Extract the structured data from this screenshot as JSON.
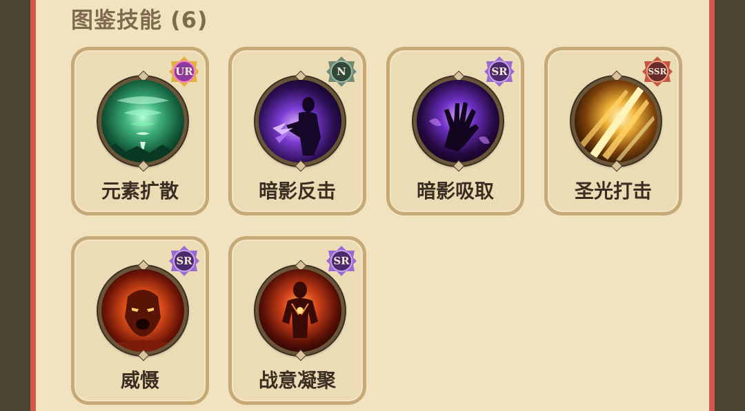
{
  "section": {
    "title": "图鉴技能 (6)"
  },
  "skills": [
    {
      "name": "元素扩散",
      "rarity": "UR",
      "icon": "green-tornado-icon",
      "theme": "green",
      "badge_color": "#8c3a9a"
    },
    {
      "name": "暗影反击",
      "rarity": "N",
      "icon": "shadow-figure-icon",
      "theme": "purple",
      "badge_color": "#2f4a3a"
    },
    {
      "name": "暗影吸取",
      "rarity": "SR",
      "icon": "shadow-hand-icon",
      "theme": "purple",
      "badge_color": "#4b2a6a"
    },
    {
      "name": "圣光打击",
      "rarity": "SSR",
      "icon": "holy-light-strike-icon",
      "theme": "gold",
      "badge_color": "#6a2a2a"
    },
    {
      "name": "威慑",
      "rarity": "SR",
      "icon": "flaming-roar-icon",
      "theme": "fire",
      "badge_color": "#4b2a6a"
    },
    {
      "name": "战意凝聚",
      "rarity": "SR",
      "icon": "flaming-warrior-icon",
      "theme": "fire",
      "badge_color": "#4b2a6a"
    }
  ]
}
